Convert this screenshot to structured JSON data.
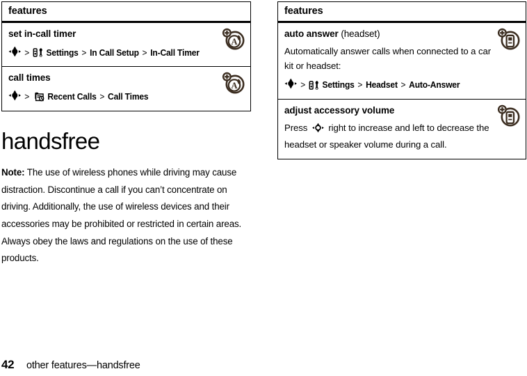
{
  "document": {
    "footer": {
      "page_number": "42",
      "section_label": "other features—handsfree"
    }
  },
  "left_column": {
    "table": {
      "header": "features",
      "rows": [
        {
          "title": "set in-call timer",
          "icon": "accessory-audio-icon",
          "menu_path": {
            "nav_key": "nav-key-icon",
            "items": [
              {
                "icon": "settings-icon",
                "label": "Settings"
              },
              {
                "icon": "",
                "label": "In Call Setup"
              },
              {
                "icon": "",
                "label": "In-Call Timer"
              }
            ],
            "separator": ">"
          }
        },
        {
          "title": "call times",
          "icon": "accessory-audio-icon",
          "menu_path": {
            "nav_key": "nav-key-icon",
            "items": [
              {
                "icon": "recent-calls-icon",
                "label": "Recent Calls"
              },
              {
                "icon": "",
                "label": "Call Times"
              }
            ],
            "separator": ">"
          }
        }
      ]
    },
    "section_heading": "handsfree",
    "note": {
      "label": "Note:",
      "text": " The use of wireless phones while driving may cause distraction. Discontinue a call if you can’t concentrate on driving. Additionally, the use of wireless devices and their accessories may be prohibited or restricted in certain areas. Always obey the laws and regulations on the use of these products."
    }
  },
  "right_column": {
    "table": {
      "header": "features",
      "rows": [
        {
          "title_bold": "auto answer",
          "title_normal": " (headset)",
          "icon": "accessory-headset-icon",
          "description": "Automatically answer calls when connected to a car kit or headset:",
          "menu_path": {
            "nav_key": "nav-key-icon",
            "items": [
              {
                "icon": "settings-icon",
                "label": "Settings"
              },
              {
                "icon": "",
                "label": "Headset"
              },
              {
                "icon": "",
                "label": "Auto-Answer"
              }
            ],
            "separator": ">"
          }
        },
        {
          "title_bold": "adjust accessory volume",
          "title_normal": "",
          "icon": "accessory-headset-icon",
          "description_before": "Press ",
          "inline_icon": "nav-key-outline-icon",
          "description_after": " right to increase and left to decrease the headset or speaker volume during a call."
        }
      ]
    }
  },
  "colors": {
    "text": "#000000",
    "icon_brown": "#3b2d20",
    "border": "#000000",
    "background": "#ffffff"
  }
}
